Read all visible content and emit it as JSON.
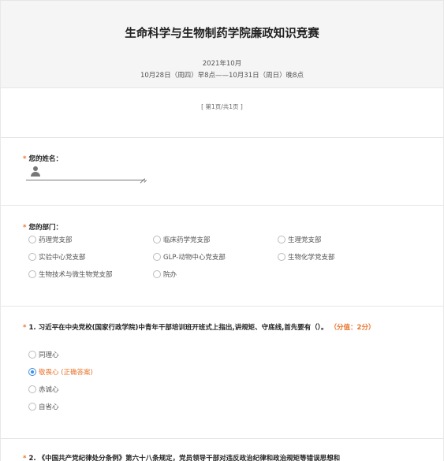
{
  "header": {
    "title": "生命科学与生物制药学院廉政知识竞赛",
    "date_line": "2021年10月",
    "period_line": "10月28日（周四）早8点——10月31日（周日）晚8点"
  },
  "pager": "[ 第1页/共1页 ]",
  "required_mark": "*",
  "name_question": {
    "label": "您的姓名：",
    "value": ""
  },
  "dept_question": {
    "label": "您的部门：",
    "options": [
      "药理党支部",
      "临床药学党支部",
      "生理党支部",
      "实验中心党支部",
      "GLP-动物中心党支部",
      "生物化学党支部",
      "生物技术与微生物党支部",
      "院办"
    ]
  },
  "q1": {
    "number": "1.",
    "text": "习近平在中央党校(国家行政学院)中青年干部培训班开班式上指出,讲规矩、守底线,首先要有（）。",
    "score": "（分值：2分）",
    "options": [
      "同理心",
      "敬畏心 (正确答案)",
      "赤诚心",
      "自省心"
    ],
    "selected_index": 1
  },
  "q2": {
    "number": "2.",
    "text": "《中国共产党纪律处分条例》第六十八条规定，党员领导干部对违反政治纪律和政治规矩等错误思想和"
  }
}
